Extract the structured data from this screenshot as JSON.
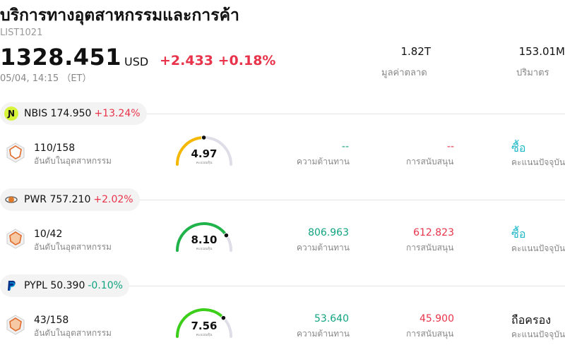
{
  "header": {
    "title": "บริการทางอุตสาหกรรมและการค้า",
    "code": "LIST1021",
    "price": "1328.451",
    "currency": "USD",
    "change": "+2.433 +0.18%",
    "time": "05/04, 14:15 （ET）",
    "stats": [
      {
        "value": "1.82T",
        "label": "มูลค่าตลาด"
      },
      {
        "value": "153.01M",
        "label": "ปริมาตร"
      }
    ]
  },
  "stocks": [
    {
      "symbol_price": "NBIS 174.950",
      "change": "+13.24%",
      "change_color": "#e8334a",
      "logo_icon": "nebius-logo-icon",
      "rank": "110/158",
      "rank_label": "อันดับในอุตสาหกรรม",
      "score": "4.97",
      "score_label": "คะแนนหุ้น",
      "score_fraction": 0.497,
      "score_color": "#f5b800",
      "resistance": "--",
      "resistance_label": "ความต้านทาน",
      "support": "--",
      "support_label": "การสนับสนุน",
      "rating": "ซื้อ",
      "rating_color": "#1fb8c9",
      "rating_label": "คะแนนปัจจุบัน"
    },
    {
      "symbol_price": "PWR 757.210",
      "change": "+2.02%",
      "change_color": "#e8334a",
      "logo_icon": "quanta-logo-icon",
      "rank": "10/42",
      "rank_label": "อันดับในอุตสาหกรรม",
      "score": "8.10",
      "score_label": "คะแนนหุ้น",
      "score_fraction": 0.81,
      "score_color": "#1fb34a",
      "resistance": "806.963",
      "resistance_label": "ความต้านทาน",
      "support": "612.823",
      "support_label": "การสนับสนุน",
      "rating": "ซื้อ",
      "rating_color": "#1fb8c9",
      "rating_label": "คะแนนปัจจุบัน"
    },
    {
      "symbol_price": "PYPL 50.390",
      "change": "-0.10%",
      "change_color": "#10a37f",
      "logo_icon": "paypal-logo-icon",
      "rank": "43/158",
      "rank_label": "อันดับในอุตสาหกรรม",
      "score": "7.56",
      "score_label": "คะแนนหุ้น",
      "score_fraction": 0.756,
      "score_color": "#3ccf1a",
      "resistance": "53.640",
      "resistance_label": "ความต้านทาน",
      "support": "45.900",
      "support_label": "การสนับสนุน",
      "rating": "ถือครอง",
      "rating_color": "#111111",
      "rating_label": "คะแนนปัจจุบัน"
    }
  ]
}
